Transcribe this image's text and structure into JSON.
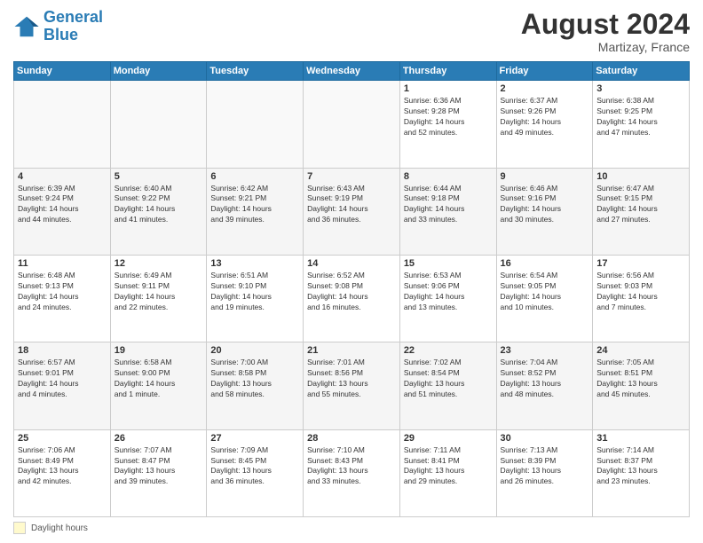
{
  "header": {
    "logo_line1": "General",
    "logo_line2": "Blue",
    "title": "August 2024",
    "subtitle": "Martizay, France"
  },
  "legend": {
    "label": "Daylight hours"
  },
  "days_of_week": [
    "Sunday",
    "Monday",
    "Tuesday",
    "Wednesday",
    "Thursday",
    "Friday",
    "Saturday"
  ],
  "weeks": [
    [
      {
        "day": "",
        "info": ""
      },
      {
        "day": "",
        "info": ""
      },
      {
        "day": "",
        "info": ""
      },
      {
        "day": "",
        "info": ""
      },
      {
        "day": "1",
        "info": "Sunrise: 6:36 AM\nSunset: 9:28 PM\nDaylight: 14 hours\nand 52 minutes."
      },
      {
        "day": "2",
        "info": "Sunrise: 6:37 AM\nSunset: 9:26 PM\nDaylight: 14 hours\nand 49 minutes."
      },
      {
        "day": "3",
        "info": "Sunrise: 6:38 AM\nSunset: 9:25 PM\nDaylight: 14 hours\nand 47 minutes."
      }
    ],
    [
      {
        "day": "4",
        "info": "Sunrise: 6:39 AM\nSunset: 9:24 PM\nDaylight: 14 hours\nand 44 minutes."
      },
      {
        "day": "5",
        "info": "Sunrise: 6:40 AM\nSunset: 9:22 PM\nDaylight: 14 hours\nand 41 minutes."
      },
      {
        "day": "6",
        "info": "Sunrise: 6:42 AM\nSunset: 9:21 PM\nDaylight: 14 hours\nand 39 minutes."
      },
      {
        "day": "7",
        "info": "Sunrise: 6:43 AM\nSunset: 9:19 PM\nDaylight: 14 hours\nand 36 minutes."
      },
      {
        "day": "8",
        "info": "Sunrise: 6:44 AM\nSunset: 9:18 PM\nDaylight: 14 hours\nand 33 minutes."
      },
      {
        "day": "9",
        "info": "Sunrise: 6:46 AM\nSunset: 9:16 PM\nDaylight: 14 hours\nand 30 minutes."
      },
      {
        "day": "10",
        "info": "Sunrise: 6:47 AM\nSunset: 9:15 PM\nDaylight: 14 hours\nand 27 minutes."
      }
    ],
    [
      {
        "day": "11",
        "info": "Sunrise: 6:48 AM\nSunset: 9:13 PM\nDaylight: 14 hours\nand 24 minutes."
      },
      {
        "day": "12",
        "info": "Sunrise: 6:49 AM\nSunset: 9:11 PM\nDaylight: 14 hours\nand 22 minutes."
      },
      {
        "day": "13",
        "info": "Sunrise: 6:51 AM\nSunset: 9:10 PM\nDaylight: 14 hours\nand 19 minutes."
      },
      {
        "day": "14",
        "info": "Sunrise: 6:52 AM\nSunset: 9:08 PM\nDaylight: 14 hours\nand 16 minutes."
      },
      {
        "day": "15",
        "info": "Sunrise: 6:53 AM\nSunset: 9:06 PM\nDaylight: 14 hours\nand 13 minutes."
      },
      {
        "day": "16",
        "info": "Sunrise: 6:54 AM\nSunset: 9:05 PM\nDaylight: 14 hours\nand 10 minutes."
      },
      {
        "day": "17",
        "info": "Sunrise: 6:56 AM\nSunset: 9:03 PM\nDaylight: 14 hours\nand 7 minutes."
      }
    ],
    [
      {
        "day": "18",
        "info": "Sunrise: 6:57 AM\nSunset: 9:01 PM\nDaylight: 14 hours\nand 4 minutes."
      },
      {
        "day": "19",
        "info": "Sunrise: 6:58 AM\nSunset: 9:00 PM\nDaylight: 14 hours\nand 1 minute."
      },
      {
        "day": "20",
        "info": "Sunrise: 7:00 AM\nSunset: 8:58 PM\nDaylight: 13 hours\nand 58 minutes."
      },
      {
        "day": "21",
        "info": "Sunrise: 7:01 AM\nSunset: 8:56 PM\nDaylight: 13 hours\nand 55 minutes."
      },
      {
        "day": "22",
        "info": "Sunrise: 7:02 AM\nSunset: 8:54 PM\nDaylight: 13 hours\nand 51 minutes."
      },
      {
        "day": "23",
        "info": "Sunrise: 7:04 AM\nSunset: 8:52 PM\nDaylight: 13 hours\nand 48 minutes."
      },
      {
        "day": "24",
        "info": "Sunrise: 7:05 AM\nSunset: 8:51 PM\nDaylight: 13 hours\nand 45 minutes."
      }
    ],
    [
      {
        "day": "25",
        "info": "Sunrise: 7:06 AM\nSunset: 8:49 PM\nDaylight: 13 hours\nand 42 minutes."
      },
      {
        "day": "26",
        "info": "Sunrise: 7:07 AM\nSunset: 8:47 PM\nDaylight: 13 hours\nand 39 minutes."
      },
      {
        "day": "27",
        "info": "Sunrise: 7:09 AM\nSunset: 8:45 PM\nDaylight: 13 hours\nand 36 minutes."
      },
      {
        "day": "28",
        "info": "Sunrise: 7:10 AM\nSunset: 8:43 PM\nDaylight: 13 hours\nand 33 minutes."
      },
      {
        "day": "29",
        "info": "Sunrise: 7:11 AM\nSunset: 8:41 PM\nDaylight: 13 hours\nand 29 minutes."
      },
      {
        "day": "30",
        "info": "Sunrise: 7:13 AM\nSunset: 8:39 PM\nDaylight: 13 hours\nand 26 minutes."
      },
      {
        "day": "31",
        "info": "Sunrise: 7:14 AM\nSunset: 8:37 PM\nDaylight: 13 hours\nand 23 minutes."
      }
    ]
  ]
}
